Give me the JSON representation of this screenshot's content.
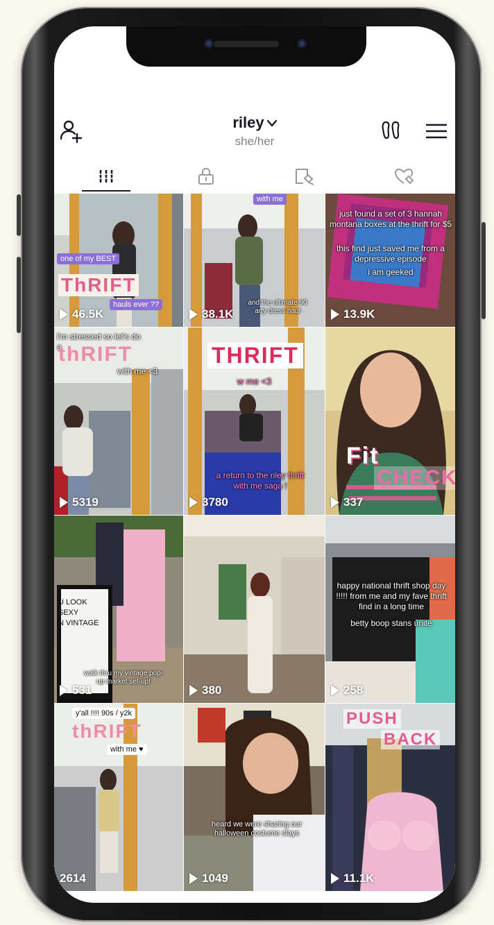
{
  "profile": {
    "username": "riley",
    "pronouns": "she/her"
  },
  "icons": {
    "add_user": "add-user-icon",
    "creator_tools": "creator-tools-icon",
    "menu": "hamburger-menu-icon"
  },
  "tabs": [
    {
      "name": "videos",
      "icon": "grid-icon",
      "active": true
    },
    {
      "name": "private",
      "icon": "lock-icon",
      "active": false
    },
    {
      "name": "reposts",
      "icon": "repost-icon",
      "active": false
    },
    {
      "name": "liked",
      "icon": "heart-icon",
      "active": false
    }
  ],
  "videos": [
    {
      "views": "46.5K",
      "captions": [
        "one of my BEST",
        "ThRIFT",
        "hauls ever ??"
      ]
    },
    {
      "views": "38.1K",
      "captions": [
        "with me",
        "and the ultimate 90",
        "arty dress haul"
      ]
    },
    {
      "views": "13.9K",
      "captions": [
        "just found a set of 3 hannah montana boxes at the thrift for $5",
        "this find just saved me from a depressive episode",
        "i am geeked"
      ]
    },
    {
      "views": "5319",
      "captions": [
        "i'm stressed so let's do a",
        "thRIFT",
        "with me <3"
      ]
    },
    {
      "views": "3780",
      "captions": [
        "THRIFT",
        "w me <3",
        "a return to the riley thrift",
        "with me saga !"
      ]
    },
    {
      "views": "337",
      "captions": [
        "Fit",
        "CHECK"
      ]
    },
    {
      "views": "531",
      "captions": [
        "U LOOK",
        "SEXY",
        "N VINTAGE",
        "walk thru my vintage pop-",
        "up market set-up!"
      ]
    },
    {
      "views": "380",
      "captions": []
    },
    {
      "views": "258",
      "captions": [
        "happy national thrift shop day !!!!! from me and my fave thrift find in a long time",
        "betty boop stans unite"
      ]
    },
    {
      "views": "2614",
      "captions": [
        "y'all !!!! 90s / y2k",
        "thRIFT",
        "with me ♥"
      ]
    },
    {
      "views": "1049",
      "captions": [
        "heard we were sharing our halloween costume slays"
      ]
    },
    {
      "views": "11.1K",
      "captions": [
        "PUSH",
        "BACK"
      ]
    }
  ],
  "colors": {
    "background": "#fbf8ef",
    "text_primary": "#161823",
    "text_secondary": "#7f7f7f"
  }
}
